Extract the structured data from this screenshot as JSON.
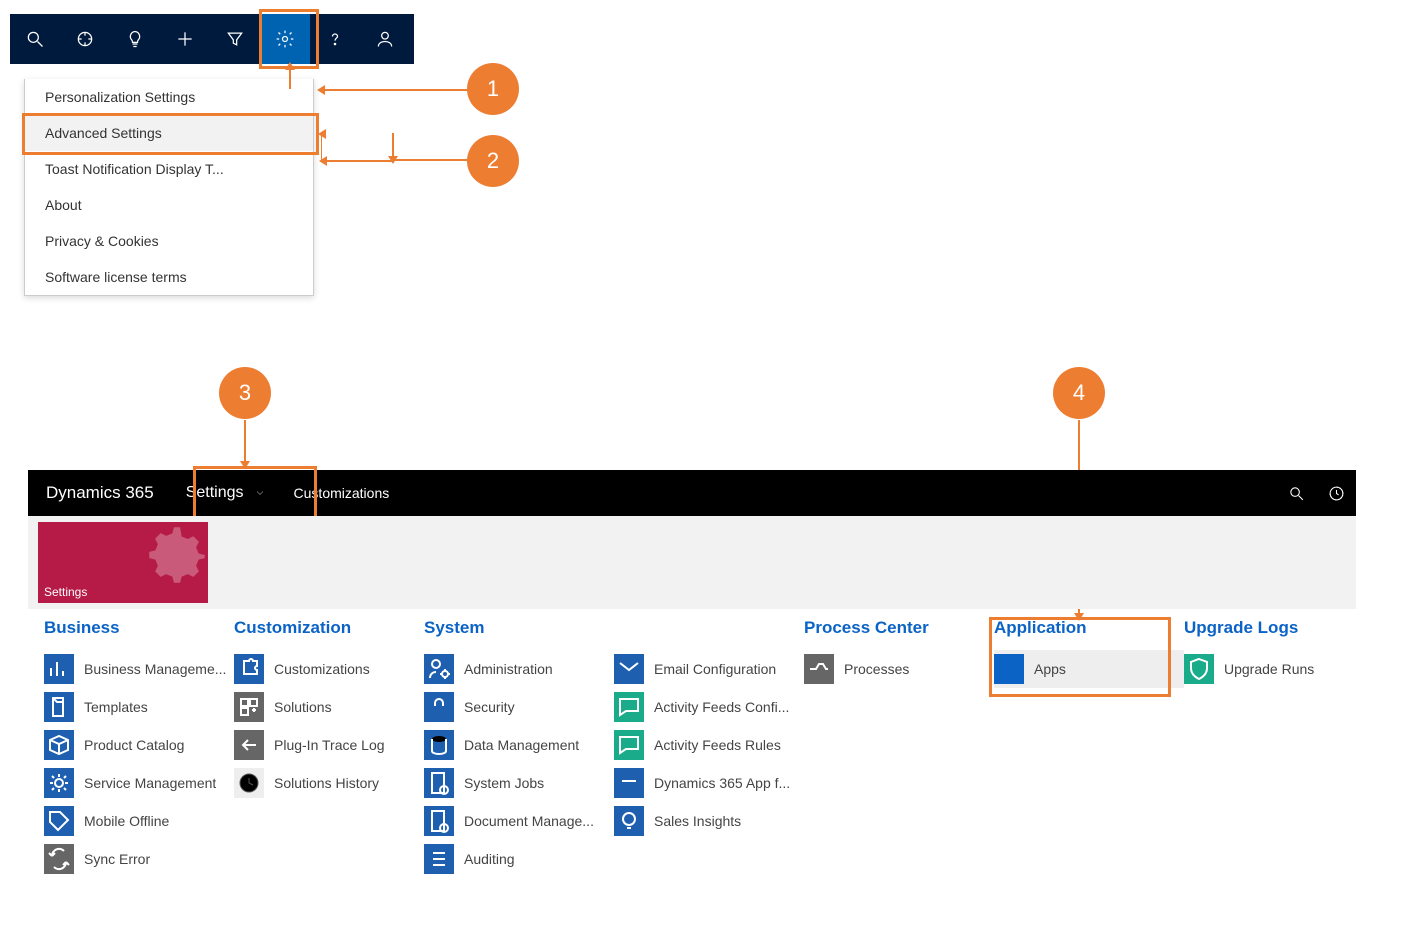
{
  "toolbar_icons": [
    "search",
    "target",
    "lightbulb",
    "plus",
    "filter",
    "gear",
    "help",
    "person"
  ],
  "dropdown": {
    "items": [
      "Personalization Settings",
      "Advanced Settings",
      "Toast Notification Display T...",
      "About",
      "Privacy & Cookies",
      "Software license terms"
    ],
    "hover_index": 1
  },
  "callouts": {
    "c1": "1",
    "c2": "2",
    "c3": "3",
    "c4": "4"
  },
  "dynbar": {
    "brand": "Dynamics 365",
    "settings_label": "Settings",
    "crumb": "Customizations"
  },
  "settings_tile": {
    "label": "Settings"
  },
  "columns": [
    {
      "title": "Business",
      "items": [
        {
          "label": "Business Manageme...",
          "icon": "chart",
          "color": "fill-blue"
        },
        {
          "label": "Templates",
          "icon": "doc",
          "color": "fill-blue"
        },
        {
          "label": "Product Catalog",
          "icon": "box",
          "color": "fill-blue"
        },
        {
          "label": "Service Management",
          "icon": "gear",
          "color": "fill-blue"
        },
        {
          "label": "Mobile Offline",
          "icon": "tag",
          "color": "fill-blue"
        },
        {
          "label": "Sync Error",
          "icon": "sync",
          "color": "fill-gray"
        }
      ]
    },
    {
      "title": "Customization",
      "items": [
        {
          "label": "Customizations",
          "icon": "puzzle",
          "color": "fill-blue"
        },
        {
          "label": "Solutions",
          "icon": "grid",
          "color": "fill-gray"
        },
        {
          "label": "Plug-In Trace Log",
          "icon": "arrow-left",
          "color": "fill-gray"
        },
        {
          "label": "Solutions History",
          "icon": "history",
          "color": "fill-ltgray"
        }
      ]
    },
    {
      "title": "System",
      "items": [
        {
          "label": "Administration",
          "icon": "user-gear",
          "color": "fill-blue"
        },
        {
          "label": "Security",
          "icon": "lock",
          "color": "fill-blue"
        },
        {
          "label": "Data Management",
          "icon": "db",
          "color": "fill-blue"
        },
        {
          "label": "System Jobs",
          "icon": "doc-gear",
          "color": "fill-blue"
        },
        {
          "label": "Document Manage...",
          "icon": "doc-gear",
          "color": "fill-blue"
        },
        {
          "label": "Auditing",
          "icon": "list",
          "color": "fill-blue"
        }
      ]
    },
    {
      "title": "",
      "items": [
        {
          "label": "Email Configuration",
          "icon": "mail",
          "color": "fill-blue"
        },
        {
          "label": "Activity Feeds Confi...",
          "icon": "chat",
          "color": "fill-teal"
        },
        {
          "label": "Activity Feeds Rules",
          "icon": "chat",
          "color": "fill-teal"
        },
        {
          "label": "Dynamics 365 App f...",
          "icon": "app",
          "color": "fill-blue"
        },
        {
          "label": "Sales Insights",
          "icon": "bulb",
          "color": "fill-blue"
        }
      ]
    },
    {
      "title": "Process Center",
      "items": [
        {
          "label": "Processes",
          "icon": "flow",
          "color": "fill-gray"
        }
      ]
    },
    {
      "title": "Application",
      "items": [
        {
          "label": "Apps",
          "icon": "apps",
          "color": "fill-blue2",
          "hover": true
        }
      ]
    },
    {
      "title": "Upgrade Logs",
      "items": [
        {
          "label": "Upgrade Runs",
          "icon": "shield",
          "color": "fill-teal"
        }
      ]
    }
  ],
  "colors": {
    "accent": "#ed7d31",
    "nav": "#001a3d",
    "brand_tile": "#b61a47",
    "link_header": "#0b63c6"
  }
}
